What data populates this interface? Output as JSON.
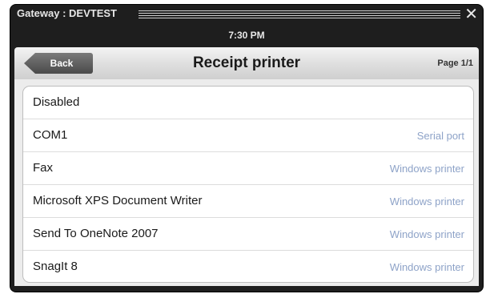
{
  "window": {
    "title": "Gateway : DEVTEST",
    "close_glyph": "✕",
    "clock": "7:30 PM"
  },
  "nav": {
    "back_label": "Back",
    "title": "Receipt printer",
    "page": "Page 1/1"
  },
  "printers": [
    {
      "name": "Disabled",
      "type": ""
    },
    {
      "name": "COM1",
      "type": "Serial port"
    },
    {
      "name": "Fax",
      "type": "Windows printer"
    },
    {
      "name": "Microsoft XPS Document Writer",
      "type": "Windows printer"
    },
    {
      "name": "Send To OneNote 2007",
      "type": "Windows printer"
    },
    {
      "name": "SnagIt 8",
      "type": "Windows printer"
    }
  ],
  "colors": {
    "window_bg": "#1e1e1e",
    "secondary_text": "#8ea3c8"
  }
}
